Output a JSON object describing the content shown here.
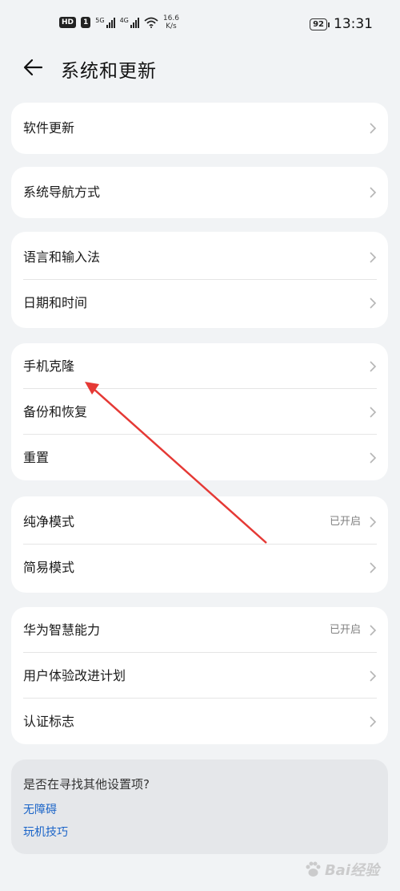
{
  "status_bar": {
    "hd": "HD",
    "sim1": "1",
    "net1": "5G",
    "net2": "4G",
    "speed_value": "16.6",
    "speed_unit": "K/s",
    "battery": "92",
    "time": "13:31"
  },
  "header": {
    "title": "系统和更新"
  },
  "groups": {
    "g1": {
      "software_update": "软件更新"
    },
    "g2": {
      "navigation": "系统导航方式"
    },
    "g3": {
      "language": "语言和输入法",
      "datetime": "日期和时间"
    },
    "g4": {
      "clone": "手机克隆",
      "backup": "备份和恢复",
      "reset": "重置"
    },
    "g5": {
      "pure_mode": "纯净模式",
      "pure_mode_status": "已开启",
      "simple_mode": "简易模式"
    },
    "g6": {
      "huawei_ai": "华为智慧能力",
      "huawei_ai_status": "已开启",
      "ux_plan": "用户体验改进计划",
      "cert": "认证标志"
    }
  },
  "suggest": {
    "question": "是否在寻找其他设置项?",
    "link1": "无障碍",
    "link2": "玩机技巧"
  },
  "watermark": {
    "text": "Bai经验"
  },
  "colors": {
    "link": "#1a64c8",
    "annotation_arrow": "#e53935"
  }
}
